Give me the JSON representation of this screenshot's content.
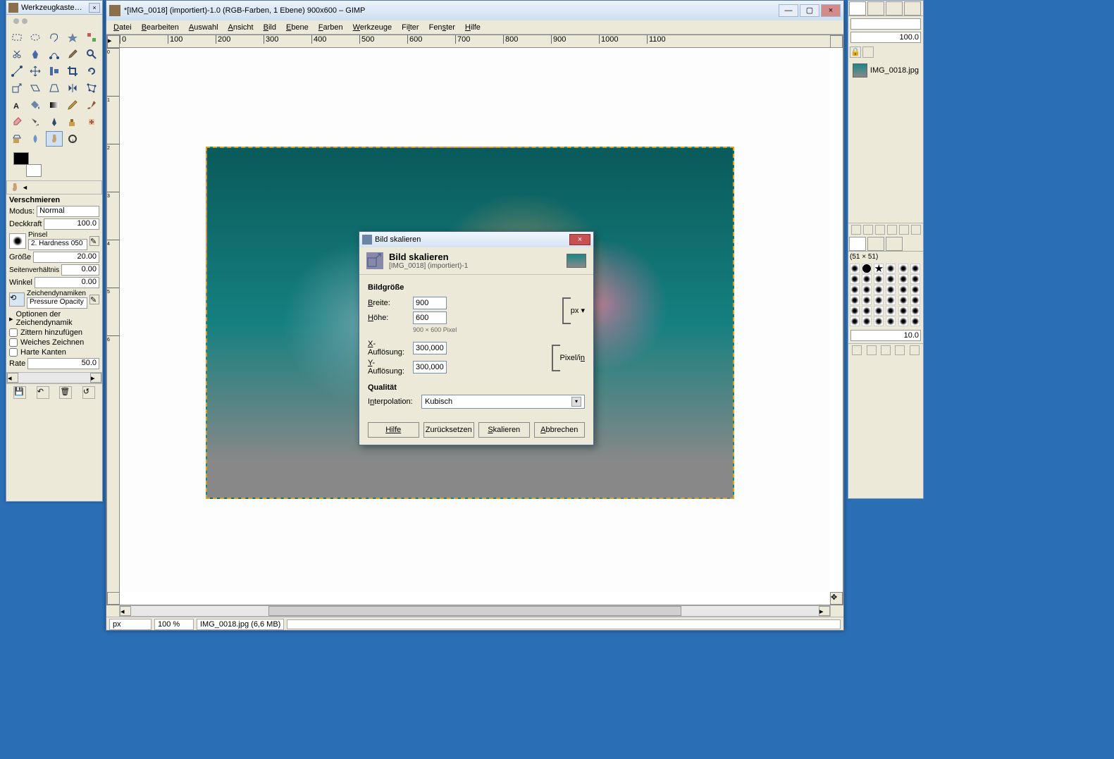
{
  "toolbox": {
    "title": "Werkzeugkasten - Werkz...",
    "section_header": "Verschmieren",
    "mode_label": "Modus:",
    "mode_value": "Normal",
    "opacity_label": "Deckkraft",
    "opacity_value": "100.0",
    "brush_label": "Pinsel",
    "brush_name": "2. Hardness 050",
    "size_label": "Größe",
    "size_value": "20.00",
    "aspect_label": "Seitenverhältnis",
    "aspect_value": "0.00",
    "angle_label": "Winkel",
    "angle_value": "0.00",
    "dynamics_label": "Zeichendynamiken",
    "dynamics_value": "Pressure Opacity",
    "dyn_options": "Optionen der Zeichendynamik",
    "jitter_label": "Zittern hinzufügen",
    "soft_label": "Weiches Zeichnen",
    "hard_label": "Harte Kanten",
    "rate_label": "Rate",
    "rate_value": "50.0"
  },
  "main": {
    "title": "*[IMG_0018] (importiert)-1.0 (RGB-Farben, 1 Ebene) 900x600 – GIMP",
    "menu": [
      "Datei",
      "Bearbeiten",
      "Auswahl",
      "Ansicht",
      "Bild",
      "Ebene",
      "Farben",
      "Werkzeuge",
      "Filter",
      "Fenster",
      "Hilfe"
    ],
    "status_unit": "px",
    "status_zoom": "100 %",
    "status_file": "IMG_0018.jpg (6,6 MB)"
  },
  "dialog": {
    "wintitle": "Bild skalieren",
    "heading": "Bild skalieren",
    "subhead": "[IMG_0018] (importiert)-1",
    "sec_size": "Bildgröße",
    "width_label": "Breite:",
    "width_value": "900",
    "height_label": "Höhe:",
    "height_value": "600",
    "size_hint": "900 × 600 Pixel",
    "xres_label": "X-Auflösung:",
    "xres_value": "300,000",
    "yres_label": "Y-Auflösung:",
    "yres_value": "300,000",
    "unit_px": "px ▾",
    "unit_res": "Pixel/in",
    "sec_quality": "Qualität",
    "interp_label": "Interpolation:",
    "interp_value": "Kubisch",
    "btn_help": "Hilfe",
    "btn_reset": "Zurücksetzen",
    "btn_scale": "Skalieren",
    "btn_cancel": "Abbrechen"
  },
  "rdock": {
    "val100": "100.0",
    "layer_name": "IMG_0018.jpg",
    "brush_info": "(51 × 51)",
    "val10": "10.0"
  },
  "ruler_h": [
    "0",
    "100",
    "200",
    "300",
    "400",
    "500",
    "600",
    "700",
    "800",
    "900",
    "1000",
    "1100"
  ],
  "ruler_v": [
    "0",
    "1",
    "2",
    "3",
    "4",
    "5",
    "6"
  ]
}
